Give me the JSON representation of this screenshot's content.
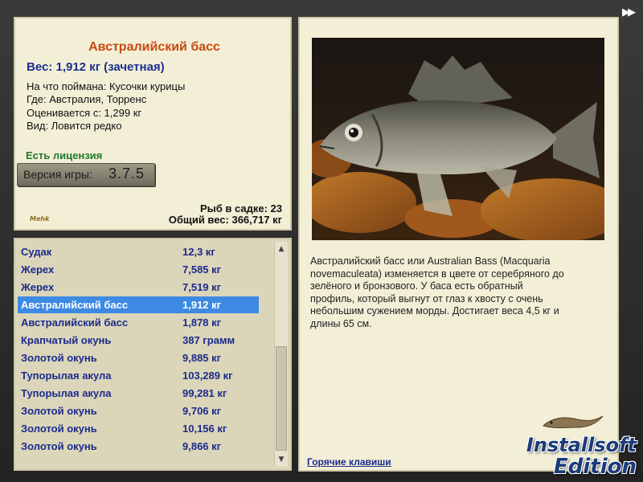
{
  "info": {
    "title": "Австралийский басс",
    "weight_line": "Вес: 1,912 кг (зачетная)",
    "details": [
      "На что поймана: Кусочки курицы",
      "Где: Австралия, Торренс",
      "Оценивается с: 1,299 кг",
      "Вид: Ловится редко"
    ],
    "license": "Есть лицензия",
    "version_label": "Версия игры:",
    "version_value": "3.7.5",
    "logo_text": "Mehk",
    "fish_in_cage": "Рыб в садке: 23",
    "total_weight": "Общий вес: 366,717 кг"
  },
  "catch_list": {
    "items": [
      {
        "name": "Судак",
        "weight": "12,3 кг"
      },
      {
        "name": "Жерех",
        "weight": "7,585 кг"
      },
      {
        "name": "Жерех",
        "weight": "7,519 кг"
      },
      {
        "name": "Австралийский басс",
        "weight": "1,912 кг",
        "selected": true
      },
      {
        "name": "Австралийский басс",
        "weight": "1,878 кг"
      },
      {
        "name": "Крапчатый окунь",
        "weight": "387 грамм"
      },
      {
        "name": "Золотой окунь",
        "weight": "9,885 кг"
      },
      {
        "name": "Тупорылая акула",
        "weight": "103,289 кг"
      },
      {
        "name": "Тупорылая акула",
        "weight": "99,281 кг"
      },
      {
        "name": "Золотой окунь",
        "weight": "9,706 кг"
      },
      {
        "name": "Золотой окунь",
        "weight": "10,156 кг"
      },
      {
        "name": "Золотой окунь",
        "weight": "9,866 кг"
      }
    ],
    "scroll_up_icon": "chevron-up-icon",
    "scroll_down_icon": "chevron-down-icon"
  },
  "description": {
    "lines": [
      "Австралийский басс или Australian Bass (Macquaria",
      "novemaculeata) изменяется в цвете от серебряного до",
      "зелёного и бронзового. У баса есть обратный",
      "профиль, который выгнут от глаз к хвосту с очень",
      "небольшим сужением морды. Достигает веса 4,5 кг и",
      "длины 65 см."
    ],
    "hotkeys_link": "Горячие клавиши"
  },
  "watermark": {
    "line1": "Installsoft",
    "line2": "Edition"
  },
  "skip_icon": "fast-forward-icon",
  "colors": {
    "title": "#c84a10",
    "weight": "#1c2f8f",
    "license": "#1e7a2a",
    "selection": "#3d8ae2",
    "panel": "#f3efd7",
    "list_bg": "#dbd6b9"
  }
}
